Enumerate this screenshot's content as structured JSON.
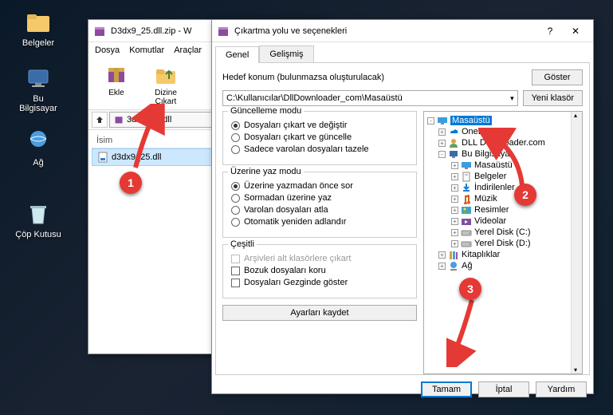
{
  "desktop": {
    "icons": [
      {
        "label": "Belgeler"
      },
      {
        "label": "Bu Bilgisayar"
      },
      {
        "label": "Ağ"
      },
      {
        "label": "Çöp Kutusu"
      }
    ]
  },
  "winrar": {
    "title": "D3dx9_25.dll.zip - W",
    "menu": [
      "Dosya",
      "Komutlar",
      "Araçlar"
    ],
    "toolbar": [
      {
        "label": "Ekle"
      },
      {
        "label": "Dizine Çıkart"
      }
    ],
    "path": "3dx9_25.dll",
    "list_header": "İsim",
    "file": "d3dx9_25.dll"
  },
  "extract": {
    "title": "Çıkartma yolu ve seçenekleri",
    "tabs": [
      "Genel",
      "Gelişmiş"
    ],
    "dest_label": "Hedef konum (bulunmazsa oluşturulacak)",
    "dest_value": "C:\\Kullanıcılar\\DllDownloader_com\\Masaüstü",
    "btn_show": "Göster",
    "btn_newfolder": "Yeni klasör",
    "group_update": "Güncelleme modu",
    "update_opts": [
      "Dosyaları çıkart ve değiştir",
      "Dosyaları çıkart ve güncelle",
      "Sadece varolan dosyaları tazele"
    ],
    "group_overwrite": "Üzerine yaz modu",
    "overwrite_opts": [
      "Üzerine yazmadan önce sor",
      "Sormadan üzerine yaz",
      "Varolan dosyaları atla",
      "Otomatik yeniden adlandır"
    ],
    "group_misc": "Çeşitli",
    "misc_archives": "Arşivleri alt klasörlere çıkart",
    "misc_broken": "Bozuk dosyaları koru",
    "misc_explorer": "Dosyaları Gezginde göster",
    "btn_save": "Ayarları kaydet",
    "tree": [
      {
        "depth": 0,
        "exp": "-",
        "icon": "desktop",
        "name": "Masaüstü",
        "sel": true
      },
      {
        "depth": 1,
        "exp": "+",
        "icon": "onedrive",
        "name": "OneDrive"
      },
      {
        "depth": 1,
        "exp": "+",
        "icon": "user",
        "name": "DLL Downloader.com"
      },
      {
        "depth": 1,
        "exp": "-",
        "icon": "pc",
        "name": "Bu Bilgisayar"
      },
      {
        "depth": 2,
        "exp": "+",
        "icon": "desktop",
        "name": "Masaüstü"
      },
      {
        "depth": 2,
        "exp": "+",
        "icon": "docs",
        "name": "Belgeler"
      },
      {
        "depth": 2,
        "exp": "+",
        "icon": "dl",
        "name": "İndirilenler"
      },
      {
        "depth": 2,
        "exp": "+",
        "icon": "music",
        "name": "Müzik"
      },
      {
        "depth": 2,
        "exp": "+",
        "icon": "pics",
        "name": "Resimler"
      },
      {
        "depth": 2,
        "exp": "+",
        "icon": "video",
        "name": "Videolar"
      },
      {
        "depth": 2,
        "exp": "+",
        "icon": "disk",
        "name": "Yerel Disk (C:)"
      },
      {
        "depth": 2,
        "exp": "+",
        "icon": "disk",
        "name": "Yerel Disk (D:)"
      },
      {
        "depth": 1,
        "exp": "+",
        "icon": "lib",
        "name": "Kitaplıklar"
      },
      {
        "depth": 1,
        "exp": "+",
        "icon": "net",
        "name": "Ağ"
      }
    ],
    "btn_ok": "Tamam",
    "btn_cancel": "İptal",
    "btn_help": "Yardım"
  },
  "markers": {
    "m1": "1",
    "m2": "2",
    "m3": "3"
  }
}
